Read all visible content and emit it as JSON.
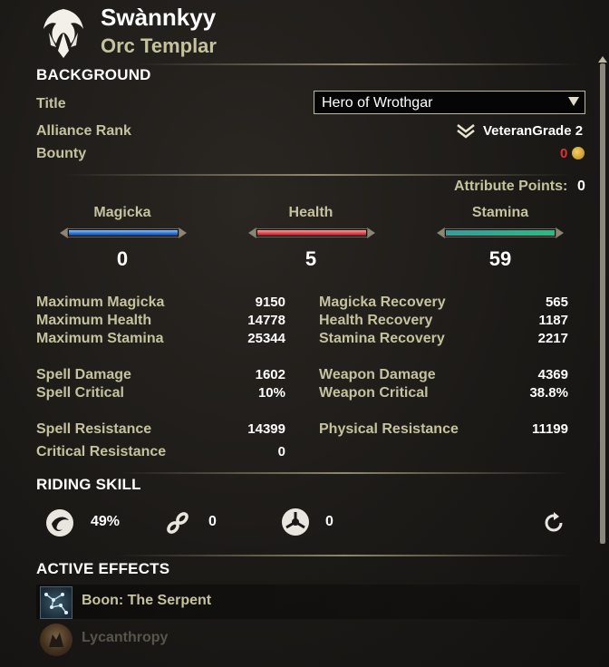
{
  "character": {
    "name": "Swànnkyy",
    "subtitle": "Orc Templar"
  },
  "background": {
    "section_title": "BACKGROUND",
    "title_label": "Title",
    "title_value": "Hero of Wrothgar",
    "alliance_rank_label": "Alliance Rank",
    "alliance_rank_value": "VeteranGrade 2",
    "bounty_label": "Bounty",
    "bounty_value": "0"
  },
  "attributes": {
    "points_label": "Attribute Points:",
    "points_value": "0",
    "items": [
      {
        "name": "Magicka",
        "value": "0",
        "color": "#3a7fd8"
      },
      {
        "name": "Health",
        "value": "5",
        "color": "#d8464e"
      },
      {
        "name": "Stamina",
        "value": "59",
        "color": "#2fb885"
      }
    ]
  },
  "stats_left": [
    {
      "label": "Maximum Magicka",
      "value": "9150"
    },
    {
      "label": "Maximum Health",
      "value": "14778"
    },
    {
      "label": "Maximum Stamina",
      "value": "25344"
    },
    {
      "label": "Spell Damage",
      "value": "1602"
    },
    {
      "label": "Spell Critical",
      "value": "10%"
    },
    {
      "label": "Spell Resistance",
      "value": "14399"
    },
    {
      "label": "Critical Resistance",
      "value": "0"
    }
  ],
  "stats_right": [
    {
      "label": "Magicka Recovery",
      "value": "565"
    },
    {
      "label": "Health Recovery",
      "value": "1187"
    },
    {
      "label": "Stamina Recovery",
      "value": "2217"
    },
    {
      "label": "Weapon Damage",
      "value": "4369"
    },
    {
      "label": "Weapon Critical",
      "value": "38.8%"
    },
    {
      "label": "Physical Resistance",
      "value": "11199"
    }
  ],
  "riding": {
    "section_title": "RIDING SKILL",
    "speed_value": "49%",
    "stamina_value": "0",
    "capacity_value": "0",
    "icons": [
      "speed-icon",
      "stamina-icon",
      "capacity-icon",
      "refresh-icon"
    ]
  },
  "active_effects": {
    "section_title": "ACTIVE EFFECTS",
    "items": [
      {
        "label": "Boon: The Serpent",
        "icon": "serpent-boon-icon"
      },
      {
        "label": "Lycanthropy",
        "icon": "lycanthropy-icon"
      }
    ]
  },
  "colors": {
    "label": "#c5c29e",
    "value": "#ffffff",
    "bounty": "#e03030",
    "gold": "#d8a020"
  }
}
